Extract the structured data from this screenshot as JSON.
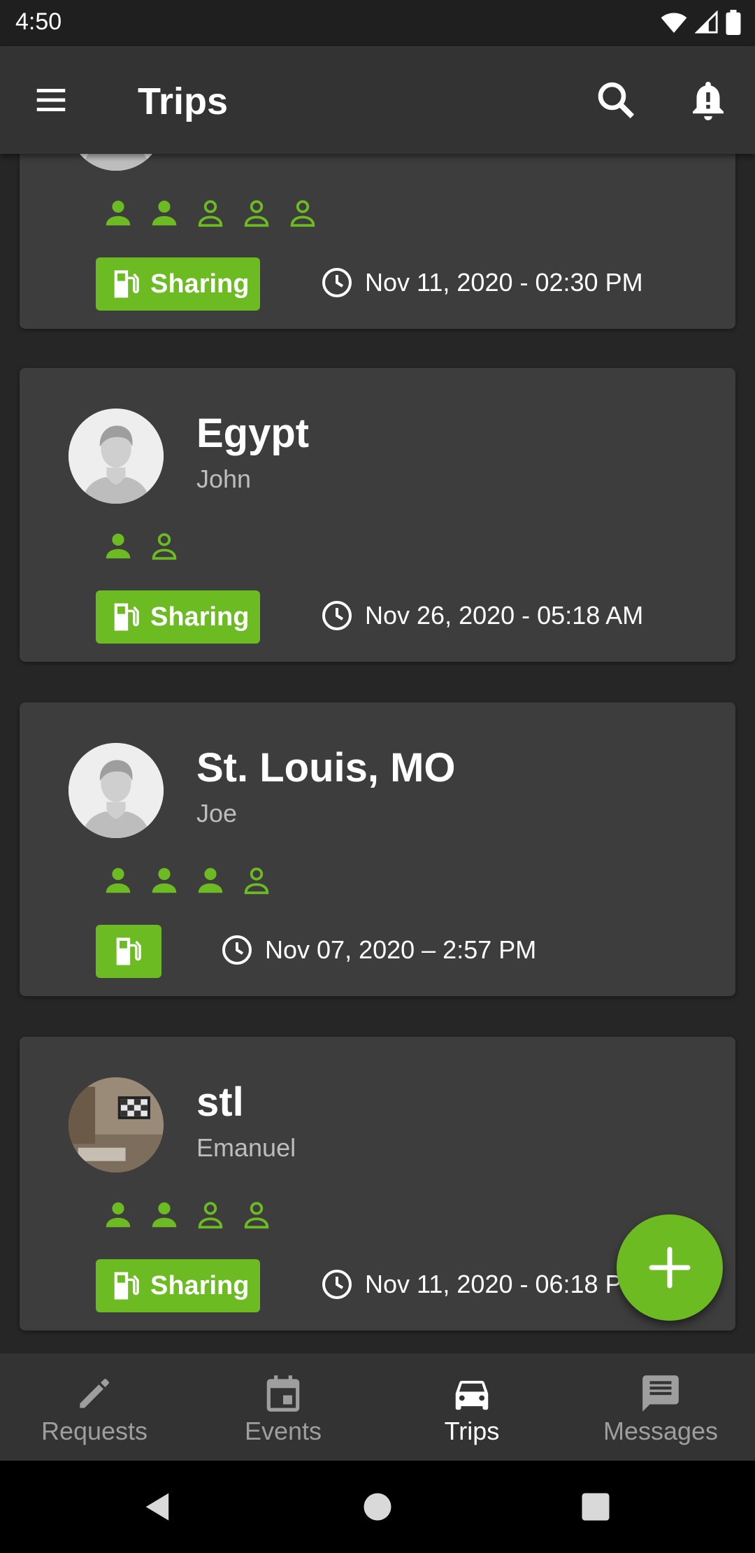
{
  "status_bar": {
    "time": "4:50"
  },
  "app_bar": {
    "title": "Trips"
  },
  "theme": {
    "accent": "#6cbb22",
    "card_bg": "#3d3d3d",
    "page_bg": "#262626"
  },
  "trips": [
    {
      "title": "",
      "driver": "",
      "seats": [
        "filled",
        "filled",
        "empty",
        "empty",
        "empty"
      ],
      "badge": "Sharing",
      "datetime": "Nov 11, 2020 - 02:30 PM",
      "avatar": "default-avatar"
    },
    {
      "title": "Egypt",
      "driver": "John",
      "seats": [
        "filled",
        "empty"
      ],
      "badge": "Sharing",
      "datetime": "Nov 26, 2020 - 05:18 AM",
      "avatar": "default-avatar"
    },
    {
      "title": "St. Louis, MO",
      "driver": "Joe",
      "seats": [
        "filled",
        "filled",
        "filled",
        "empty"
      ],
      "badge": "",
      "datetime": "Nov 07, 2020 – 2:57 PM",
      "avatar": "default-avatar"
    },
    {
      "title": "stl",
      "driver": "Emanuel",
      "seats": [
        "filled",
        "filled",
        "empty",
        "empty"
      ],
      "badge": "Sharing",
      "datetime": "Nov 11, 2020 - 06:18 PM",
      "avatar": "photo-avatar"
    }
  ],
  "bottom_nav": {
    "items": [
      {
        "label": "Requests",
        "icon": "pencil-icon"
      },
      {
        "label": "Events",
        "icon": "calendar-icon"
      },
      {
        "label": "Trips",
        "icon": "car-icon",
        "active": true
      },
      {
        "label": "Messages",
        "icon": "message-icon"
      }
    ]
  }
}
